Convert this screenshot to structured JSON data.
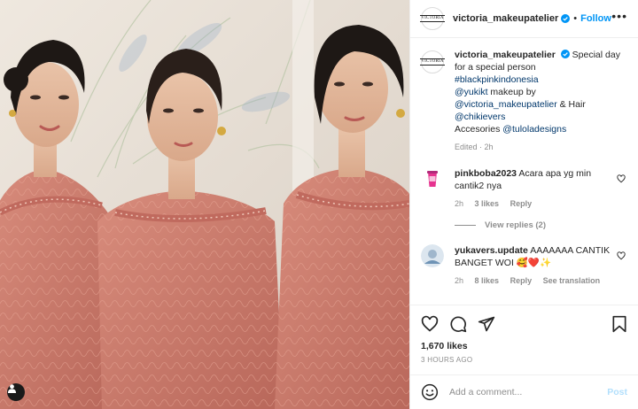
{
  "header": {
    "username": "victoria_makeupatelier",
    "follow_label": "Follow",
    "separator": "•",
    "more_label": "•••"
  },
  "caption": {
    "username": "victoria_makeupatelier",
    "text": "Special day for a special person",
    "hashtag": "#blackpinkindonesia",
    "mention_1": "@yukikt",
    "text_2": "makeup by",
    "mention_2": "@victoria_makeupatelier",
    "text_3": "& Hair",
    "mention_3": "@chikievers",
    "text_4": "Accesories",
    "mention_4": "@tuloladesigns",
    "edited": "Edited · 2h",
    "logo_text": "VICTORIA"
  },
  "comments": [
    {
      "username": "pinkboba2023",
      "text": "Acara apa yg min cantik2 nya",
      "time": "2h",
      "likes": "3 likes",
      "reply": "Reply"
    },
    {
      "username": "yukavers.update",
      "text": "AAAAAAA CANTIK BANGET WOI 🥰❤️✨",
      "time": "2h",
      "likes": "8 likes",
      "reply": "Reply",
      "translate": "See translation"
    }
  ],
  "view_replies": "View replies (2)",
  "likes": "1,670 likes",
  "timestamp": "3 HOURS AGO",
  "add_comment": {
    "placeholder": "Add a comment...",
    "post_label": "Post"
  },
  "colors": {
    "accent": "#0095f6",
    "link": "#00376b",
    "muted": "#8e8e8e",
    "post_disabled": "#b2dffc",
    "dress": "#c9786a"
  },
  "icons": [
    "verified-badge-icon",
    "more-icon",
    "heart-icon",
    "comment-icon",
    "share-icon",
    "bookmark-icon",
    "emoji-icon",
    "user-tag-icon"
  ]
}
